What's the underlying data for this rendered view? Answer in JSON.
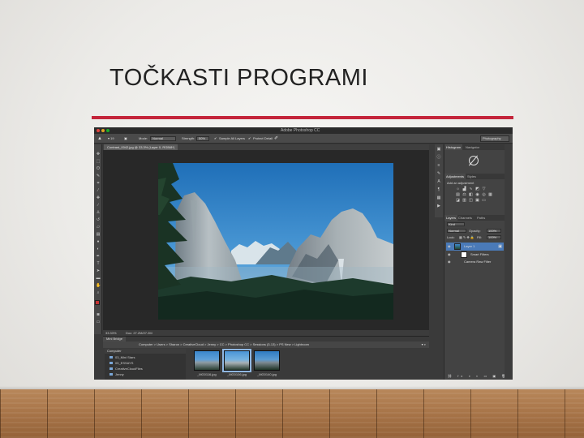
{
  "slide": {
    "title": "TOČKASTI PROGRAMI",
    "accent_color": "#c4253b"
  },
  "app": {
    "window_title": "Adobe Photoshop CC",
    "workspace": "Photography",
    "options_bar": {
      "mode_label": "Mode:",
      "mode_value": "Normal",
      "strength_label": "Strength:",
      "strength_value": "50%",
      "sample_all_layers": "Sample All Layers",
      "protect_detail": "Protect Detail"
    },
    "document_tab": "Contrast_0042.jpg @ 33.3% (Layer 0, RGB/8*)",
    "status_zoom": "33.33%",
    "status_doc": "Doc: 27.2M/27.2M",
    "panels": {
      "top_tabs": [
        "Histogram",
        "Navigator"
      ],
      "adjustments_tabs": [
        "Adjustments",
        "Styles"
      ],
      "adjustments_hint": "Add an adjustment",
      "layers_tabs": [
        "Layers",
        "Channels",
        "Paths"
      ],
      "blend_mode": "Normal",
      "opacity_label": "Opacity:",
      "opacity_value": "100%",
      "lock_label": "Lock:",
      "fill_label": "Fill:",
      "fill_value": "100%",
      "layers": [
        "Layer 1",
        "Smart Filters",
        "Camera Raw Filter"
      ]
    },
    "mini_bridge": {
      "tab": "Mini Bridge",
      "path": "Computer  >  Users  >  Sharon  >  CreativeCloud  >  Jenny  >  CC  >  Photoshop CC  >  Sessions (3-13)  >  PS New  >  Lightroom",
      "sidebar_header": "Computer",
      "folders": [
        "03_Mini Stars",
        "05_ESSAYS",
        "CreativeCloudFiles",
        "Jenny"
      ],
      "thumbnails": [
        "_MG0116.jpg",
        "_MG0106.jpg",
        "_MG0140.jpg"
      ]
    },
    "colors": {
      "foreground_swatch": "#c33434",
      "background_swatch": "#ffffff",
      "selection_blue": "#4a7ab8"
    }
  }
}
